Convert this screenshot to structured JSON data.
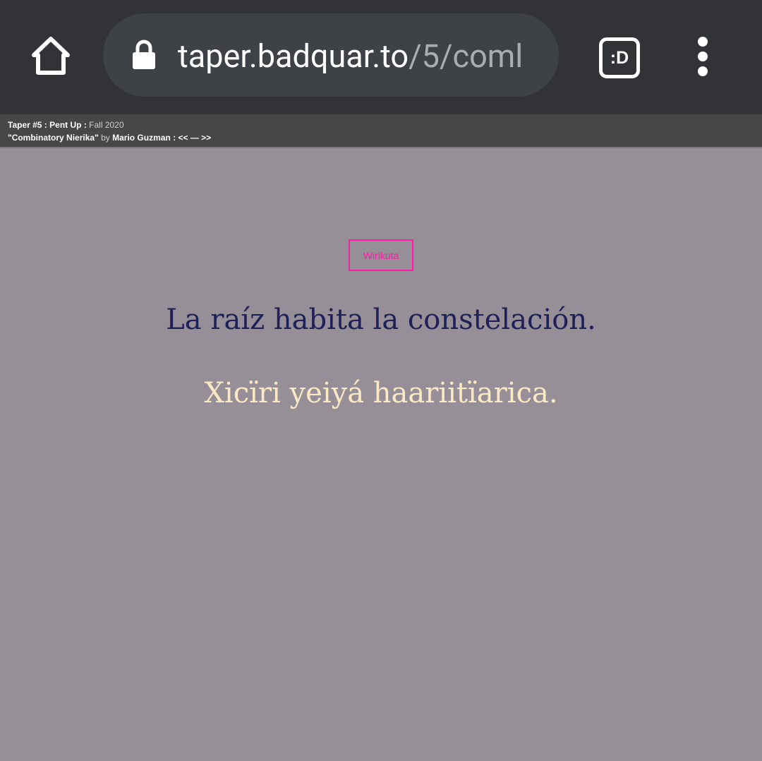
{
  "browser": {
    "url_host": "taper.badquar.to",
    "url_path": "/5/coml",
    "extension_badge": ":D",
    "icons": {
      "home": "home-icon",
      "lock": "lock-icon",
      "extension": "extension-icon",
      "menu": "more-vert-icon"
    }
  },
  "site_header": {
    "issue": "Taper #5",
    "sep1": " : ",
    "issue_title": "Pent Up",
    "sep2": " : ",
    "season": "Fall 2020",
    "work_title": "\"Combinatory Nierika\"",
    "by": " by ",
    "author": "Mario Guzman",
    "sep3": " : ",
    "prev": "<<",
    "dash": " — ",
    "next": ">>"
  },
  "main": {
    "tag": "Wirikuta",
    "line_spanish": "La raíz habita la constelación.",
    "line_huichol": "Xicïri yeiyá haariitïarica."
  },
  "colors": {
    "chrome_bg": "#323336",
    "urlbar_bg": "#3e4246",
    "page_bg": "#968f97",
    "tag_accent": "#ff1aa8",
    "spanish_text": "#1e2057",
    "huichol_text": "#fbe8c4"
  }
}
